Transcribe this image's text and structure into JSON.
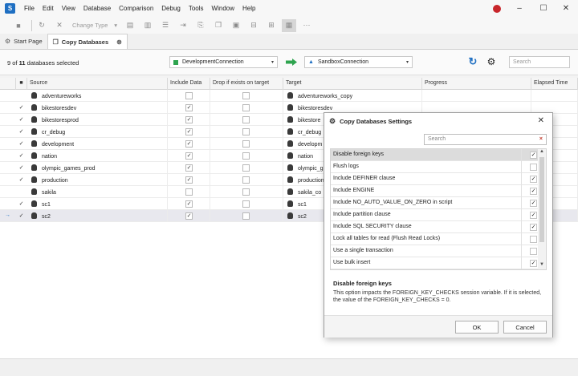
{
  "menu": {
    "items": [
      "File",
      "Edit",
      "View",
      "Database",
      "Comparison",
      "Debug",
      "Tools",
      "Window",
      "Help"
    ],
    "logo": "S"
  },
  "window_controls": {
    "minimize": "–",
    "maximize": "☐",
    "close": "✕"
  },
  "toolbar": {
    "change_type_label": "Change Type"
  },
  "tabs": [
    {
      "label": "Start Page",
      "icon": "gear-icon"
    },
    {
      "label": "Copy Databases",
      "icon": "copy-icon",
      "close": "⊗"
    }
  ],
  "connection_bar": {
    "selected_count": "9",
    "total_count": "11",
    "selected_text_of": "of",
    "selected_text_suffix": "databases selected",
    "source_connection": "DevelopmentConnection",
    "target_connection": "SandboxConnection",
    "source_color": "#2ea44f",
    "target_color": "#1f6fc2",
    "search_placeholder": "Search"
  },
  "grid": {
    "columns": [
      "Source",
      "Include Data",
      "Drop if exists on target",
      "Target",
      "Progress",
      "Elapsed Time"
    ],
    "rows": [
      {
        "checked": "",
        "source": "adventureworks",
        "include_data": "",
        "drop": "",
        "target": "adventureworks_copy"
      },
      {
        "checked": "✓",
        "source": "bikestoresdev",
        "include_data": "✓",
        "drop": "",
        "target": "bikestoresdev"
      },
      {
        "checked": "✓",
        "source": "bikestoresprod",
        "include_data": "✓",
        "drop": "",
        "target": "bikestore"
      },
      {
        "checked": "✓",
        "source": "cr_debug",
        "include_data": "✓",
        "drop": "",
        "target": "cr_debug"
      },
      {
        "checked": "✓",
        "source": "development",
        "include_data": "✓",
        "drop": "",
        "target": "developm"
      },
      {
        "checked": "✓",
        "source": "nation",
        "include_data": "✓",
        "drop": "",
        "target": "nation"
      },
      {
        "checked": "✓",
        "source": "olympic_games_prod",
        "include_data": "✓",
        "drop": "",
        "target": "olympic_g"
      },
      {
        "checked": "✓",
        "source": "production",
        "include_data": "✓",
        "drop": "",
        "target": "production"
      },
      {
        "checked": "",
        "source": "sakila",
        "include_data": "",
        "drop": "",
        "target": "sakila_co"
      },
      {
        "checked": "✓",
        "source": "sc1",
        "include_data": "✓",
        "drop": "",
        "target": "sc1"
      },
      {
        "checked": "✓",
        "source": "sc2",
        "include_data": "✓",
        "drop": "",
        "target": "sc2"
      }
    ],
    "current_row_marker": "→"
  },
  "dialog": {
    "title": "Copy Databases Settings",
    "close": "✕",
    "search_placeholder": "Search",
    "search_clear": "×",
    "options": [
      {
        "label": "Disable foreign keys",
        "checked": "✓"
      },
      {
        "label": "Flush logs",
        "checked": ""
      },
      {
        "label": "Include DEFINER clause",
        "checked": "✓"
      },
      {
        "label": "Include ENGINE",
        "checked": "✓"
      },
      {
        "label": "Include NO_AUTO_VALUE_ON_ZERO in script",
        "checked": "✓"
      },
      {
        "label": "Include partition clause",
        "checked": "✓"
      },
      {
        "label": "Include SQL SECURITY clause",
        "checked": "✓"
      },
      {
        "label": "Lock all tables for read (Flush Read Locks)",
        "checked": ""
      },
      {
        "label": "Use a single transaction",
        "checked": ""
      },
      {
        "label": "Use bulk insert",
        "checked": "✓"
      }
    ],
    "scroll_up": "▲",
    "scroll_down": "▼",
    "description_title": "Disable foreign keys",
    "description_text": "This option impacts the FOREIGN_KEY_CHECKS session variable. If it is selected, the value of the FOREIGN_KEY_CHECKS = 0.",
    "ok_label": "OK",
    "cancel_label": "Cancel"
  }
}
